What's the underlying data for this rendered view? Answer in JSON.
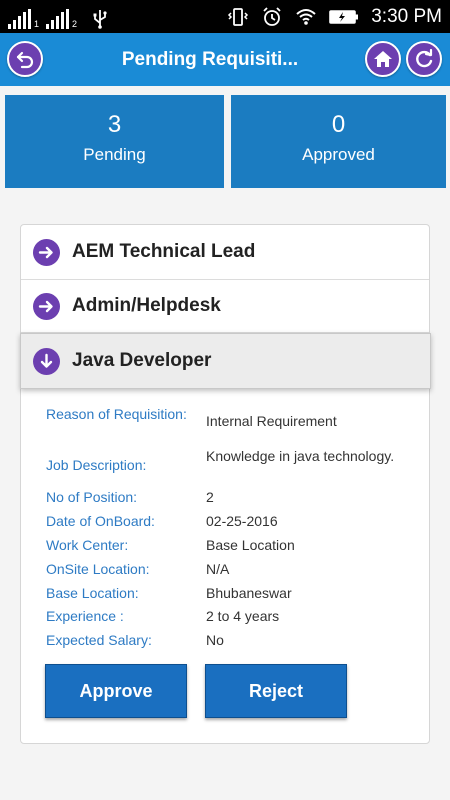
{
  "status_bar": {
    "sim1": "1",
    "sim2": "2",
    "time": "3:30 PM"
  },
  "app_bar": {
    "title": "Pending Requisiti..."
  },
  "stats": {
    "pending": {
      "count": "3",
      "label": "Pending"
    },
    "approved": {
      "count": "0",
      "label": "Approved"
    }
  },
  "requisitions": [
    {
      "title": "AEM Technical Lead",
      "expanded": false
    },
    {
      "title": "Admin/Helpdesk",
      "expanded": false
    },
    {
      "title": "Java Developer",
      "expanded": true
    }
  ],
  "details": {
    "reason": {
      "label": "Reason of Requisition:",
      "value": "Internal Requirement"
    },
    "job_description": {
      "label": "Job Description:",
      "value": "Knowledge in java technology."
    },
    "positions": {
      "label": "No of Position:",
      "value": "2"
    },
    "onboard": {
      "label": "Date of OnBoard:",
      "value": "02-25-2016"
    },
    "work_center": {
      "label": "Work Center:",
      "value": "Base Location"
    },
    "onsite": {
      "label": "OnSite Location:",
      "value": "N/A"
    },
    "base": {
      "label": "Base Location:",
      "value": "Bhubaneswar"
    },
    "experience": {
      "label": "Experience :",
      "value": "2 to 4 years"
    },
    "salary": {
      "label": "Expected Salary:",
      "value": "No"
    }
  },
  "actions": {
    "approve": "Approve",
    "reject": "Reject"
  },
  "colors": {
    "app_bar": "#1a8bd6",
    "stat_tile": "#1b7cc1",
    "accent_purple": "#6c3fb0",
    "label_blue": "#2e7bc4",
    "button_blue": "#1a6fc0"
  },
  "icons": {
    "back": "back-arrow-icon",
    "home": "home-icon",
    "refresh": "refresh-icon",
    "collapsed": "arrow-right-circle-icon",
    "expanded": "arrow-down-circle-icon"
  }
}
